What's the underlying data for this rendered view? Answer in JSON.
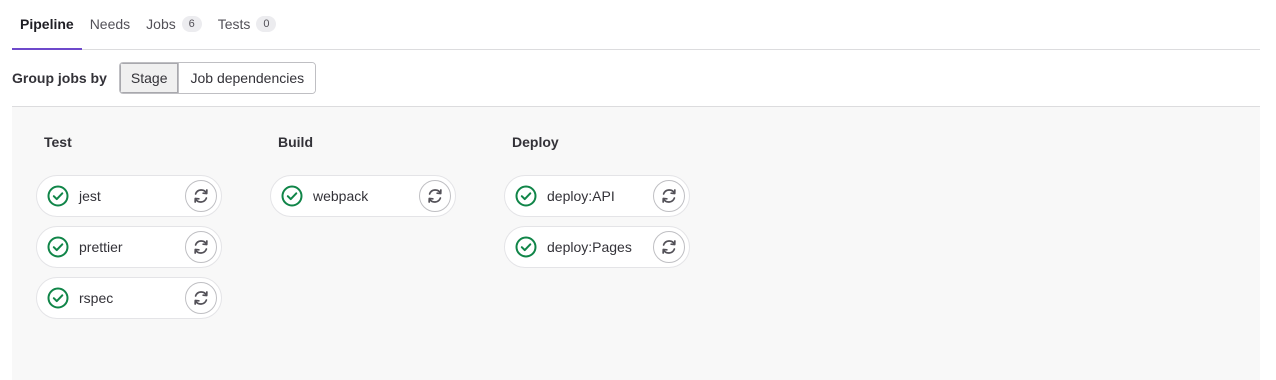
{
  "tabs": [
    {
      "label": "Pipeline",
      "active": true
    },
    {
      "label": "Needs"
    },
    {
      "label": "Jobs",
      "count": "6"
    },
    {
      "label": "Tests",
      "count": "0"
    }
  ],
  "group_bar": {
    "label": "Group jobs by",
    "options": [
      "Stage",
      "Job dependencies"
    ],
    "selected": "Stage"
  },
  "stages": [
    {
      "title": "Test",
      "jobs": [
        "jest",
        "prettier",
        "rspec"
      ]
    },
    {
      "title": "Build",
      "jobs": [
        "webpack"
      ]
    },
    {
      "title": "Deploy",
      "jobs": [
        "deploy:API",
        "deploy:Pages"
      ]
    }
  ],
  "colors": {
    "success": "#108548",
    "active_tab_underline": "#6e49cb"
  },
  "icons": {
    "job_status": "status-success-icon",
    "job_action": "retry-icon"
  }
}
